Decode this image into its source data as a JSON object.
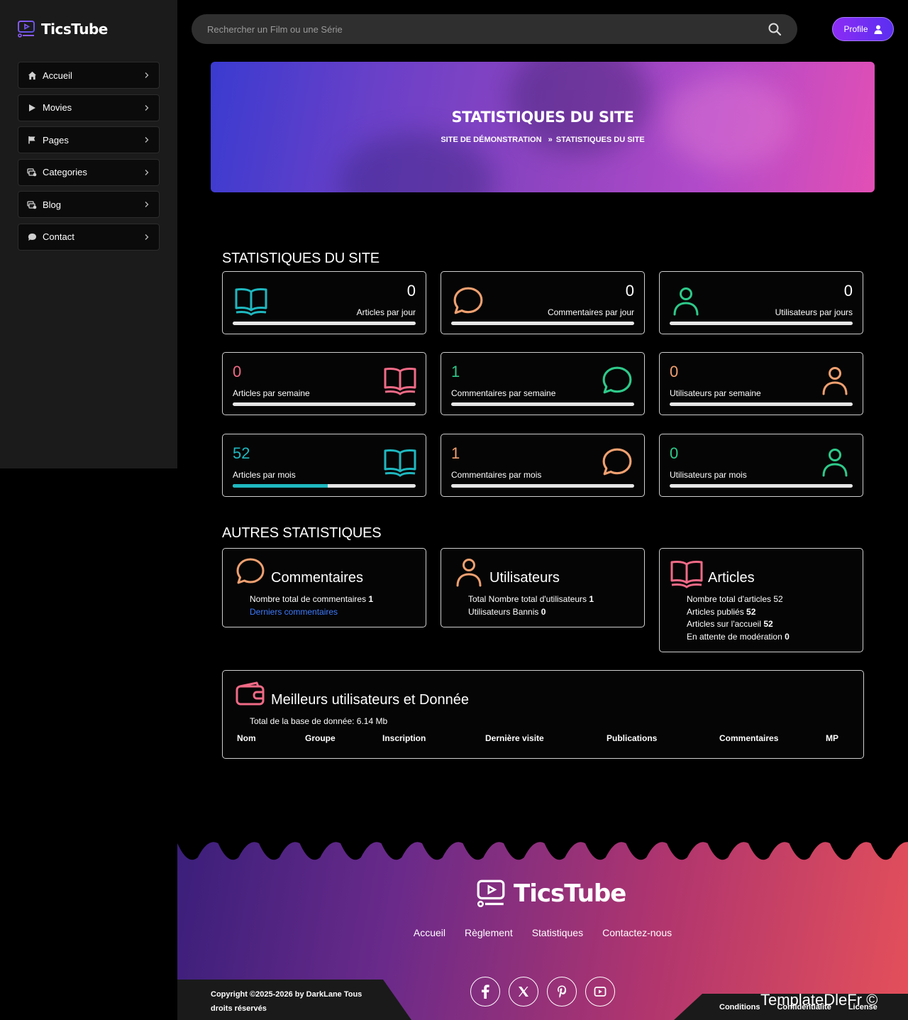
{
  "app": {
    "name": "TicsTube"
  },
  "sidebar": {
    "items": [
      {
        "label": "Accueil",
        "icon": "home-icon"
      },
      {
        "label": "Movies",
        "icon": "play-icon"
      },
      {
        "label": "Pages",
        "icon": "flag-icon"
      },
      {
        "label": "Categories",
        "icon": "folders-icon"
      },
      {
        "label": "Blog",
        "icon": "folders-icon"
      },
      {
        "label": "Contact",
        "icon": "chat-icon"
      }
    ]
  },
  "header": {
    "search_placeholder": "Rechercher un Film ou une Série",
    "profile_label": "Profile"
  },
  "banner": {
    "title": "STATISTIQUES DU SITE",
    "crumb_home": "SITE DE DÉMONSTRATION",
    "crumb_sep": "»",
    "crumb_current": "STATISTIQUES DU SITE"
  },
  "stats": {
    "title": "STATISTIQUES DU SITE",
    "cards": [
      {
        "value": "0",
        "label": "Articles par jour",
        "icon": "book-icon",
        "color": "#1fb8c0",
        "progress": 0
      },
      {
        "value": "0",
        "label": "Commentaires par jour",
        "icon": "comment-icon",
        "color": "#f0a070",
        "progress": 0
      },
      {
        "value": "0",
        "label": "Utilisateurs par jours",
        "icon": "user-icon",
        "color": "#2ec98a",
        "progress": 0
      },
      {
        "value": "0",
        "label": "Articles par semaine",
        "icon": "book-icon",
        "color": "#f06a86",
        "progress": 0
      },
      {
        "value": "1",
        "label": "Commentaires par semaine",
        "icon": "comment-icon",
        "color": "#2ec98a",
        "progress": 0
      },
      {
        "value": "0",
        "label": "Utilisateurs par semaine",
        "icon": "user-icon",
        "color": "#f0a070",
        "progress": 0
      },
      {
        "value": "52",
        "label": "Articles par mois",
        "icon": "book-icon",
        "color": "#1fb8c0",
        "progress": 0.52
      },
      {
        "value": "1",
        "label": "Commentaires par mois",
        "icon": "comment-icon",
        "color": "#f0a070",
        "progress": 0
      },
      {
        "value": "0",
        "label": "Utilisateurs par mois",
        "icon": "user-icon",
        "color": "#2ec98a",
        "progress": 0
      }
    ]
  },
  "other": {
    "title": "AUTRES STATISTIQUES",
    "comments": {
      "title": "Commentaires",
      "total_label": "Nombre total de commentaires",
      "total_value": "1",
      "link": "Derniers commentaires"
    },
    "users": {
      "title": "Utilisateurs",
      "total_label": "Total Nombre total d'utilisateurs",
      "total_value": "1",
      "banned_label": "Utilisateurs Bannis",
      "banned_value": "0"
    },
    "articles": {
      "title": "Articles",
      "total_label": "Nombre total d'articles 52",
      "published_label": "Articles publiés",
      "published_value": "52",
      "home_label": "Articles sur l'accueil",
      "home_value": "52",
      "pending_label": "En attente de modération",
      "pending_value": "0"
    }
  },
  "best": {
    "title": "Meilleurs utilisateurs et Donnée",
    "db_size": "Total de la base de donnée: 6.14 Mb",
    "columns": [
      "Nom",
      "Groupe",
      "Inscription",
      "Dernière visite",
      "Publications",
      "Commentaires",
      "MP"
    ]
  },
  "footer": {
    "links": [
      "Accueil",
      "Règlement",
      "Statistiques",
      "Contactez-nous"
    ],
    "copyright": "Copyright ©2025-2026 by DarkLane Tous droits réservés",
    "legal": [
      "Conditions",
      "Confidentialité",
      "License"
    ],
    "watermark": "TemplateDleFr ©"
  }
}
